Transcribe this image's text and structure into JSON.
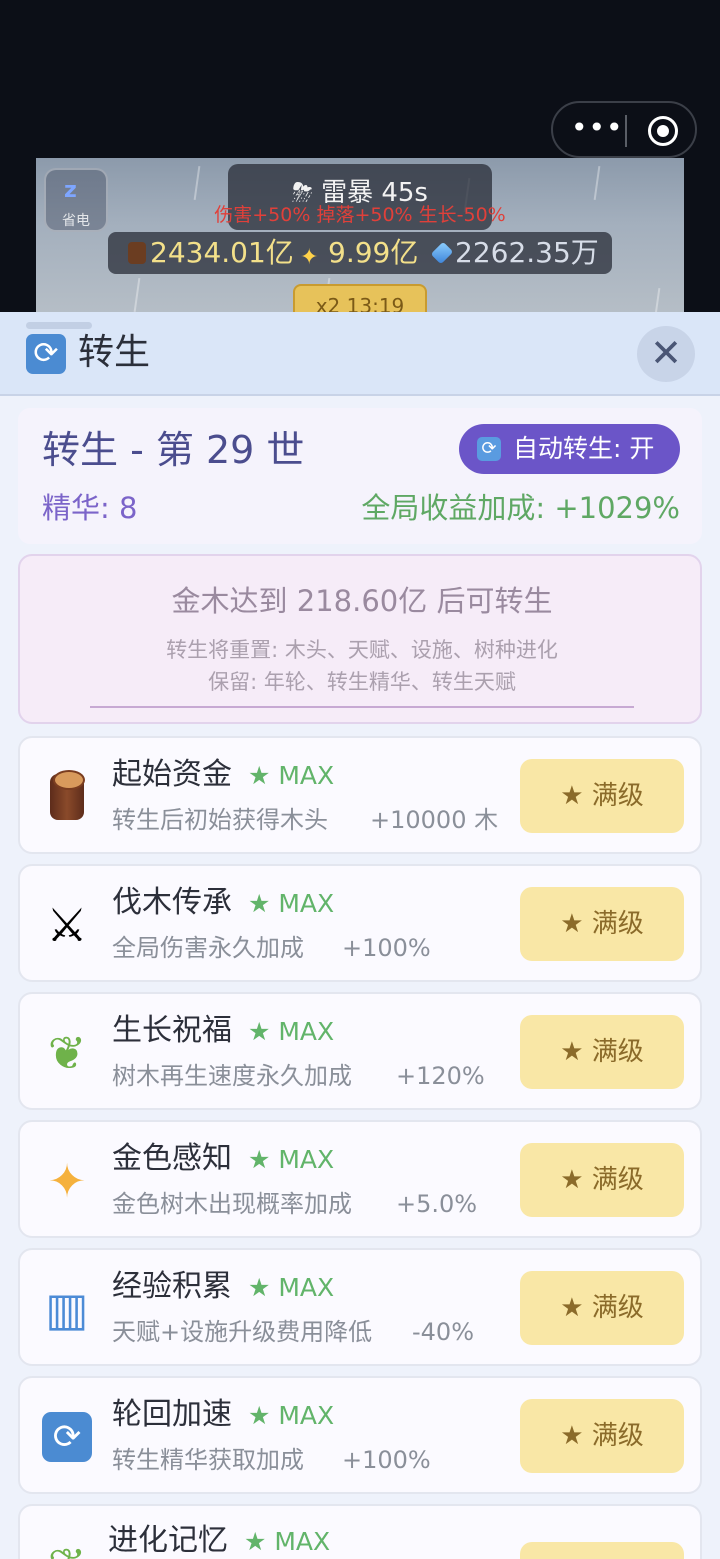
{
  "game": {
    "sleep_label": "省电",
    "weather_title": "⛈ 雷暴 45s",
    "weather_effect": "伤害+50% 掉落+50% 生长-50%",
    "wood_amount": "2434.01亿",
    "gold_amount": "9.99亿",
    "gem_amount": "2262.35万",
    "multiplier": "x2 13:19"
  },
  "panel": {
    "title": "转生",
    "close_icon": "close-icon",
    "rebirth_title": "转生 - 第 29 世",
    "auto_rebirth": "自动转生: 开",
    "essence": "精华: 8",
    "global_bonus": "全局收益加成: +1029%",
    "requirement": "金木达到 218.60亿 后可转生",
    "reset_note": "转生将重置: 木头、天赋、设施、树种进化",
    "keep_note": "保留: 年轮、转生精华、转生天赋"
  },
  "talents": [
    {
      "name": "起始资金",
      "max": "★ MAX",
      "desc": "转生后初始获得木头",
      "value": "+10000 木",
      "button": "★  满级",
      "icon": "wood-log-icon"
    },
    {
      "name": "伐木传承",
      "max": "★ MAX",
      "desc": "全局伤害永久加成",
      "value": "+100%",
      "button": "★  满级",
      "icon": "crossed-swords-icon"
    },
    {
      "name": "生长祝福",
      "max": "★ MAX",
      "desc": "树木再生速度永久加成",
      "value": "+120%",
      "button": "★  满级",
      "icon": "sprout-icon"
    },
    {
      "name": "金色感知",
      "max": "★ MAX",
      "desc": "金色树木出现概率加成",
      "value": "+5.0%",
      "button": "★  满级",
      "icon": "sparkles-icon"
    },
    {
      "name": "经验积累",
      "max": "★ MAX",
      "desc": "天赋+设施升级费用降低",
      "value": "-40%",
      "button": "★  满级",
      "icon": "book-icon"
    },
    {
      "name": "轮回加速",
      "max": "★ MAX",
      "desc": "转生精华获取加成",
      "value": "+100%",
      "button": "★  满级",
      "icon": "cycle-icon"
    },
    {
      "name": "进化记忆",
      "max": "★ MAX",
      "desc": "",
      "value": "",
      "button": "",
      "icon": "sprout-icon"
    }
  ]
}
